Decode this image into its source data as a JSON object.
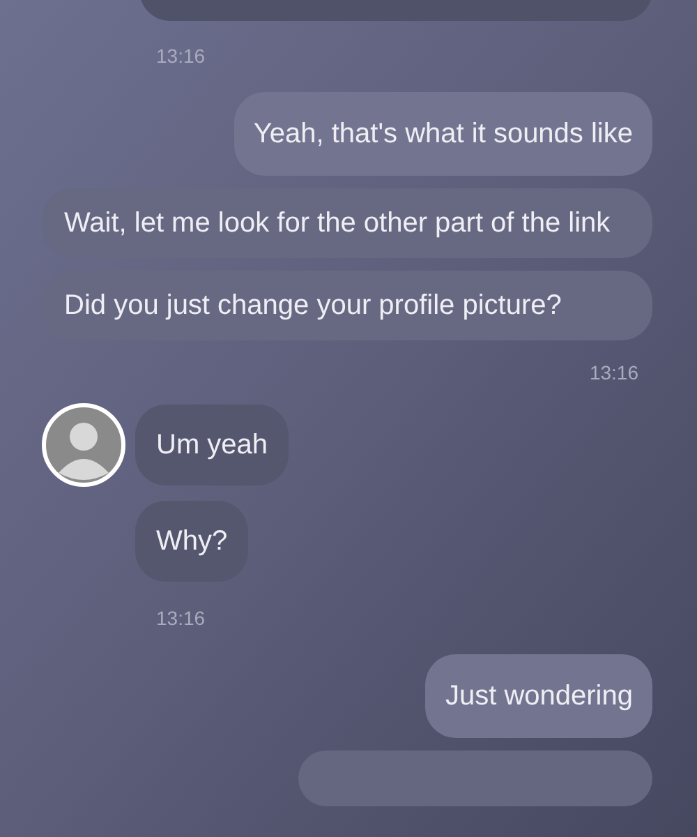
{
  "messages": [
    {
      "kind": "cut_received"
    },
    {
      "kind": "time_left",
      "text": "13:16"
    },
    {
      "kind": "sent",
      "text": "Yeah, that's what it sounds like"
    },
    {
      "kind": "received_wide",
      "text": "Wait, let me look for the other part of the link"
    },
    {
      "kind": "received_wide",
      "text": "Did you just change your profile picture?"
    },
    {
      "kind": "time_right",
      "text": "13:16"
    },
    {
      "kind": "received",
      "avatar": true,
      "text": "Um yeah"
    },
    {
      "kind": "received",
      "avatar": false,
      "text": "Why?"
    },
    {
      "kind": "time_left",
      "text": "13:16"
    },
    {
      "kind": "sent",
      "text": "Just wondering"
    },
    {
      "kind": "cut_sent"
    }
  ]
}
